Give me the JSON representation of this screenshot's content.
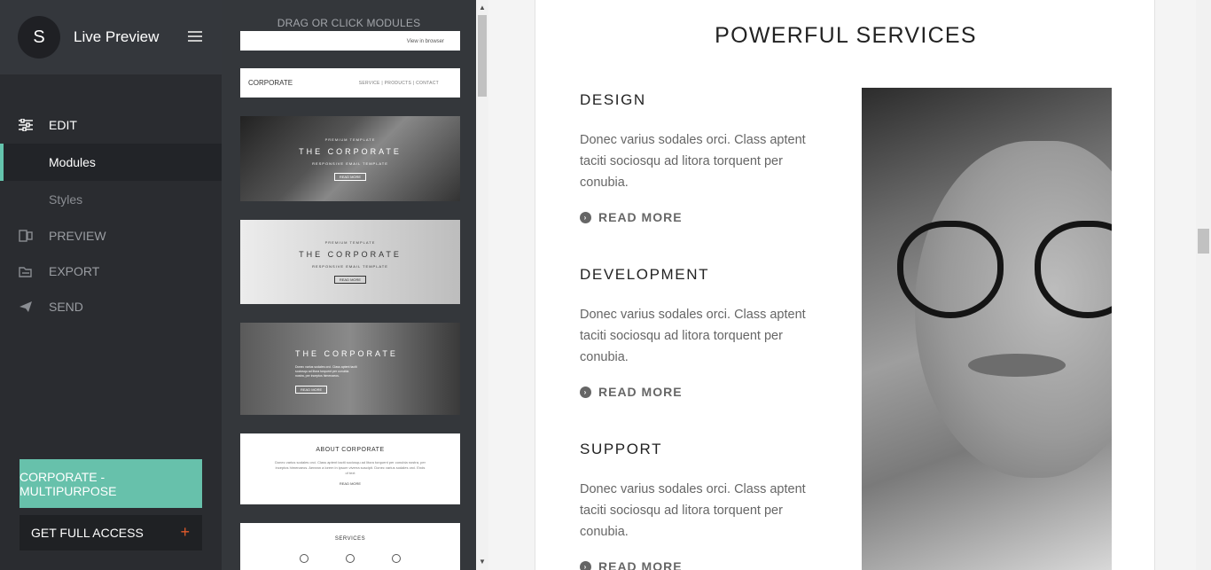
{
  "sidebar": {
    "avatar_letter": "S",
    "title": "Live Preview",
    "nav": {
      "edit": "EDIT",
      "modules": "Modules",
      "styles": "Styles",
      "preview": "PREVIEW",
      "export": "EXPORT",
      "send": "SEND"
    },
    "theme_button": "CORPORATE - MULTIPURPOSE",
    "access_button": "GET FULL ACCESS",
    "access_plus": "+"
  },
  "modules": {
    "title": "DRAG OR CLICK MODULES",
    "thumb1": {
      "text": "View in browser"
    },
    "thumb2": {
      "brand": "CORPORATE",
      "links": "SERVICE  |  PRODUCTS  |  CONTACT"
    },
    "thumb3": {
      "pre": "PREMIUM TEMPLATE",
      "big": "THE CORPORATE",
      "sub": "RESPONSIVE EMAIL TEMPLATE",
      "rm": "READ MORE"
    },
    "thumb4": {
      "pre": "PREMIUM TEMPLATE",
      "big": "THE CORPORATE",
      "sub": "RESPONSIVE EMAIL TEMPLATE",
      "rm": "READ MORE"
    },
    "thumb5": {
      "big": "THE CORPORATE",
      "para": "Donec varius sodales orci. Class aptent taciti sociosqu ad litora torquent per conubia nostra, per inceptos himenaeos.",
      "rm": "READ MORE"
    },
    "thumb6": {
      "heading": "ABOUT CORPORATE",
      "para": "Donec varius sodales orci. Class aptent taciti sociosqu ad litora torquent per conubia nostra, per inceptos himenaeos. Aenean a lorem in ipsum viverra suscipit. Donec varius sodales orci. Ends of text",
      "rm": "READ MORE"
    },
    "thumb7": {
      "heading": "SERVICES"
    }
  },
  "preview": {
    "section_title": "POWERFUL SERVICES",
    "services": [
      {
        "heading": "DESIGN",
        "text": "Donec varius sodales orci. Class aptent taciti sociosqu ad litora torquent per conubia.",
        "link": "READ MORE"
      },
      {
        "heading": "DEVELOPMENT",
        "text": "Donec varius sodales orci. Class aptent taciti sociosqu ad litora torquent per conubia.",
        "link": "READ MORE"
      },
      {
        "heading": "SUPPORT",
        "text": "Donec varius sodales orci. Class aptent taciti sociosqu ad litora torquent per conubia.",
        "link": "READ MORE"
      }
    ]
  },
  "colors": {
    "accent": "#67c1ab",
    "sidebar_bg": "#2a2c30",
    "panel_bg": "#34373b",
    "plus_icon": "#e05a2b"
  },
  "icons": {
    "edit": "sliders-icon",
    "preview": "preview-icon",
    "export": "export-icon",
    "send": "paper-plane-icon",
    "menu": "hamburger-icon",
    "read_more": "chevron-circle-right-icon"
  }
}
